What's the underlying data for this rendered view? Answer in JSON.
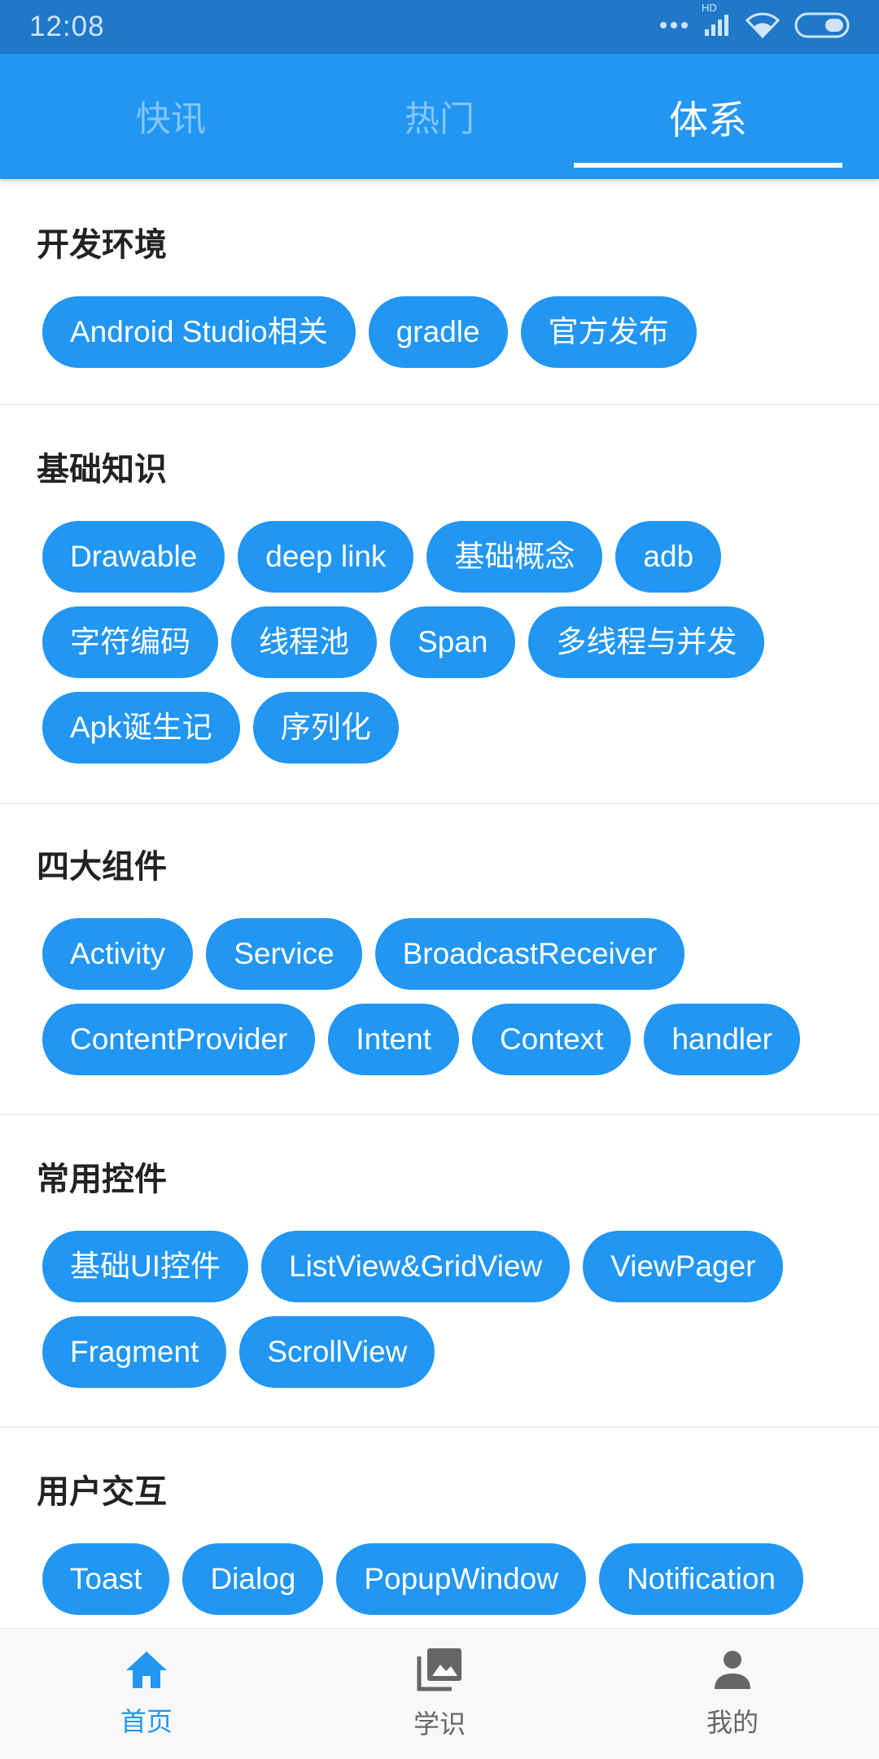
{
  "status": {
    "time": "12:08",
    "network": "HD"
  },
  "tabs": [
    {
      "label": "快讯",
      "active": false
    },
    {
      "label": "热门",
      "active": false
    },
    {
      "label": "体系",
      "active": true
    }
  ],
  "sections": [
    {
      "title": "开发环境",
      "chips": [
        "Android Studio相关",
        "gradle",
        "官方发布"
      ]
    },
    {
      "title": "基础知识",
      "chips": [
        "Drawable",
        "deep link",
        "基础概念",
        "adb",
        "字符编码",
        "线程池",
        "Span",
        "多线程与并发",
        "Apk诞生记",
        "序列化"
      ]
    },
    {
      "title": "四大组件",
      "chips": [
        "Activity",
        "Service",
        "BroadcastReceiver",
        "ContentProvider",
        "Intent",
        "Context",
        "handler"
      ]
    },
    {
      "title": "常用控件",
      "chips": [
        "基础UI控件",
        "ListView&GridView",
        "ViewPager",
        "Fragment",
        "ScrollView"
      ]
    },
    {
      "title": "用户交互",
      "chips": [
        "Toast",
        "Dialog",
        "PopupWindow",
        "Notification",
        "",
        "",
        ""
      ]
    }
  ],
  "bottom_nav": [
    {
      "label": "首页",
      "icon": "home-icon",
      "active": true
    },
    {
      "label": "学识",
      "icon": "photo-library-icon",
      "active": false
    },
    {
      "label": "我的",
      "icon": "person-icon",
      "active": false
    }
  ],
  "colors": {
    "primary": "#2196f3",
    "status_bar": "#1f78c8",
    "chip_text": "#ffffff",
    "nav_inactive": "#666666"
  }
}
